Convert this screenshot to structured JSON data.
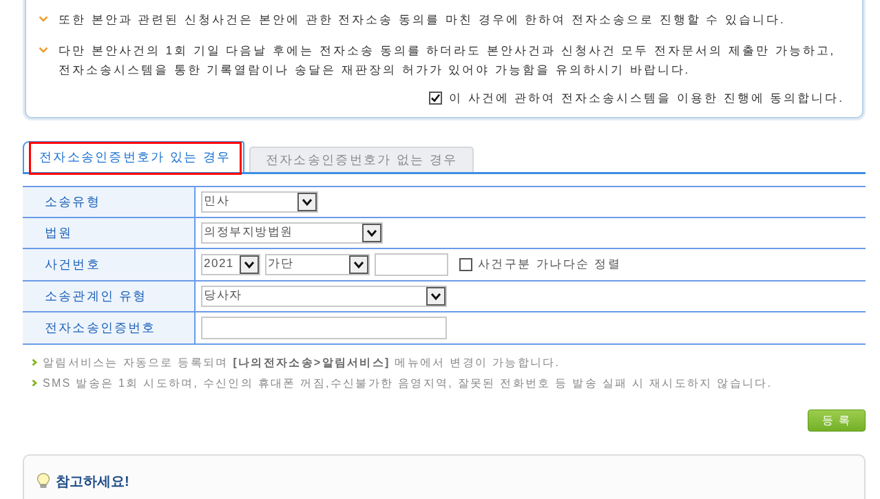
{
  "notice": {
    "items": [
      {
        "lines": [
          "또한 본안과 관련된 신청사건은 본안에 관한 전자소송 동의를 마친 경우에 한하여 전자소송으로 진행할 수 있습니다."
        ]
      },
      {
        "lines": [
          "다만 본안사건의 1회 기일 다음날 후에는 전자소송 동의를 하더라도 본안사건과 신청사건 모두 전자문서의 제출만 가능하고,",
          "전자소송시스템을 통한 기록열람이나 송달은 재판장의 허가가 있어야 가능함을 유의하시기 바랍니다."
        ]
      }
    ],
    "consent": {
      "label": "이 사건에 관하여 전자소송시스템을 이용한 진행에 동의합니다.",
      "checked": true
    }
  },
  "tabs": [
    {
      "label": "전자소송인증번호가 있는 경우",
      "selected": true,
      "highlighted": true
    },
    {
      "label": "전자소송인증번호가 없는 경우",
      "selected": false,
      "highlighted": false
    }
  ],
  "form": {
    "rows": [
      {
        "label": "소송유형",
        "controls": [
          {
            "kind": "select",
            "value": "민사"
          }
        ]
      },
      {
        "label": "법원",
        "controls": [
          {
            "kind": "select",
            "value": "의정부지방법원"
          }
        ]
      },
      {
        "label": "사건번호",
        "controls": [
          {
            "kind": "select",
            "value": "2021"
          },
          {
            "kind": "select",
            "value": "가단"
          },
          {
            "kind": "text-input"
          },
          {
            "kind": "checkbox",
            "label": "사건구분 가나다순 정렬",
            "checked": false
          }
        ]
      },
      {
        "label": "소송관계인 유형",
        "controls": [
          {
            "kind": "select",
            "value": "당사자"
          }
        ]
      },
      {
        "label": "전자소송인증번호",
        "controls": [
          {
            "kind": "text-input"
          }
        ]
      }
    ]
  },
  "notes": [
    "알림서비스는 자동으로 등록되며 **[나의전자소송>알림서비스]** 메뉴에서 변경이 가능합니다.",
    "SMS 발송은 1회 시도하며, 수신인의 휴대폰 꺼짐,수신불가한 음영지역, 잘못된 전화번호 등 발송 실패 시 재시도하지 않습니다."
  ],
  "register_button": {
    "label": "등 록"
  },
  "reference_panel": {
    "title": "참고하세요!"
  }
}
